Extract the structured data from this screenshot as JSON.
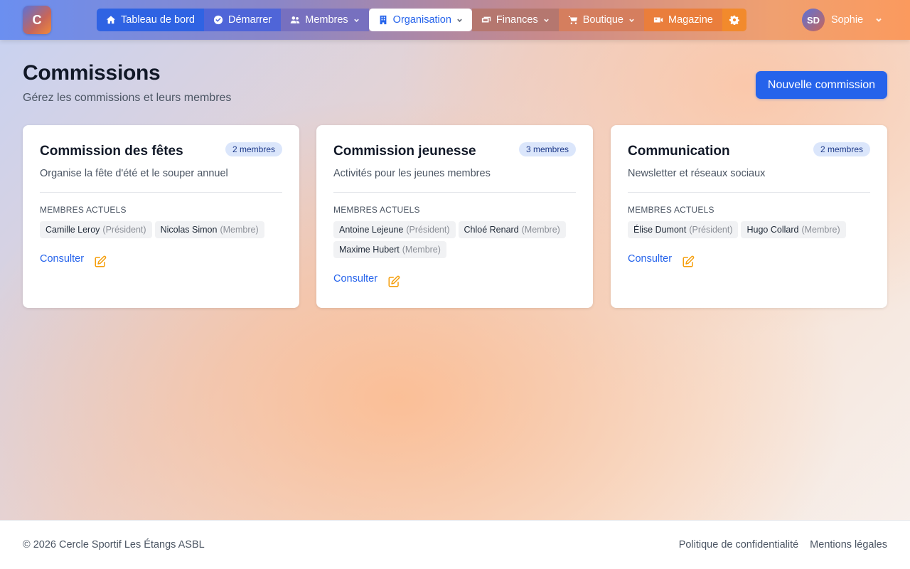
{
  "app": {
    "logo_letter": "C"
  },
  "nav": {
    "items": [
      {
        "label": "Tableau de bord",
        "icon": "home-icon"
      },
      {
        "label": "Démarrer",
        "icon": "check-circle-icon"
      },
      {
        "label": "Membres",
        "icon": "users-icon",
        "has_dropdown": true
      },
      {
        "label": "Organisation",
        "icon": "building-icon",
        "has_dropdown": true,
        "active": true
      },
      {
        "label": "Finances",
        "icon": "money-icon",
        "has_dropdown": true
      },
      {
        "label": "Boutique",
        "icon": "cart-icon",
        "has_dropdown": true
      },
      {
        "label": "Magazine",
        "icon": "video-icon"
      },
      {
        "label": "",
        "icon": "gear-icon"
      }
    ]
  },
  "user": {
    "initials": "SD",
    "name": "Sophie"
  },
  "header": {
    "title": "Commissions",
    "subtitle": "Gérez les commissions et leurs membres",
    "new_button": "Nouvelle commission"
  },
  "cards": [
    {
      "title": "Commission des fêtes",
      "badge": "2 membres",
      "description": "Organise la fête d'été et le souper annuel",
      "members_label": "MEMBRES ACTUELS",
      "members": [
        {
          "name": "Camille Leroy",
          "role": "(Président)"
        },
        {
          "name": "Nicolas Simon",
          "role": "(Membre)"
        }
      ],
      "consult": "Consulter"
    },
    {
      "title": "Commission jeunesse",
      "badge": "3 membres",
      "description": "Activités pour les jeunes membres",
      "members_label": "MEMBRES ACTUELS",
      "members": [
        {
          "name": "Antoine Lejeune",
          "role": "(Président)"
        },
        {
          "name": "Chloé Renard",
          "role": "(Membre)"
        },
        {
          "name": "Maxime Hubert",
          "role": "(Membre)"
        }
      ],
      "consult": "Consulter"
    },
    {
      "title": "Communication",
      "badge": "2 membres",
      "description": "Newsletter et réseaux sociaux",
      "members_label": "MEMBRES ACTUELS",
      "members": [
        {
          "name": "Élise Dumont",
          "role": "(Président)"
        },
        {
          "name": "Hugo Collard",
          "role": "(Membre)"
        }
      ],
      "consult": "Consulter"
    }
  ],
  "footer": {
    "copyright": "© 2026 Cercle Sportif Les Étangs ASBL",
    "links": [
      "Politique de confidentialité",
      "Mentions légales"
    ]
  },
  "colors": {
    "accent": "#2563eb",
    "edit_icon": "#f59e0b",
    "badge_bg": "#dbe6fb"
  }
}
